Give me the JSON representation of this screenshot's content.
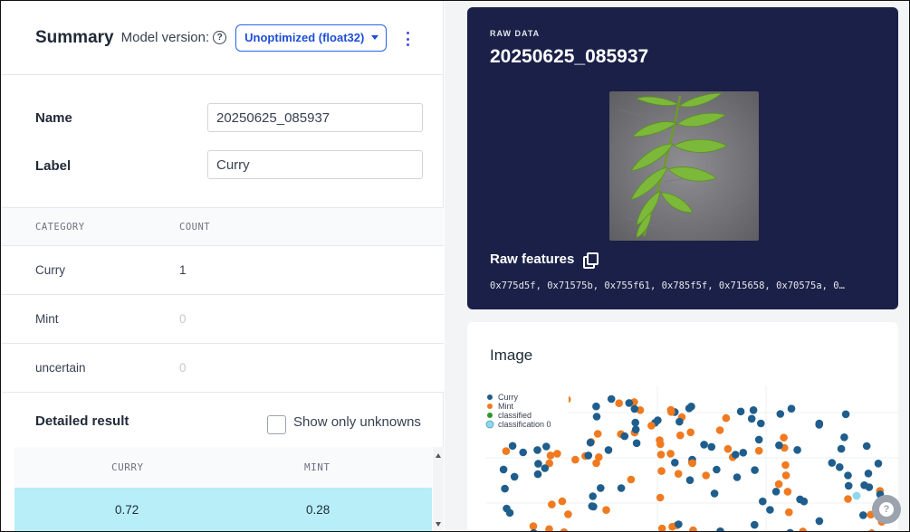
{
  "summary": {
    "title": "Summary",
    "model_version_label": "Model version:",
    "help_icon": "help-circle-icon",
    "model_version_value": "Unoptimized (float32)",
    "menu_icon": "vertical-dots-icon"
  },
  "fields": {
    "name_label": "Name",
    "name_value": "20250625_085937",
    "label_label": "Label",
    "label_value": "Curry"
  },
  "category_table": {
    "headers": [
      "CATEGORY",
      "COUNT"
    ],
    "rows": [
      {
        "category": "Curry",
        "count": "1"
      },
      {
        "category": "Mint",
        "count": "0"
      },
      {
        "category": "uncertain",
        "count": "0"
      }
    ]
  },
  "detailed": {
    "title": "Detailed result",
    "checkbox_label": "Show only unknowns",
    "headers": [
      "CURRY",
      "MINT"
    ],
    "rows": [
      {
        "curry": "0.72",
        "mint": "0.28"
      }
    ]
  },
  "raw": {
    "eyebrow": "RAW DATA",
    "title": "20250625_085937",
    "features_label": "Raw features",
    "features_hex": "0x775d5f, 0x71575b, 0x755f61, 0x785f5f, 0x715658, 0x70575a, 0…"
  },
  "image_panel": {
    "title": "Image",
    "legend": [
      {
        "name": "Curry",
        "color": "#1f5e8c"
      },
      {
        "name": "Mint",
        "color": "#f07a1f"
      },
      {
        "name": "classified",
        "color": "#2a9a2a"
      },
      {
        "name": "classification 0",
        "color": "#8fd8ec"
      }
    ]
  },
  "colors": {
    "accent": "#2563eb",
    "raw_card_bg": "#1b2048",
    "selected_row": "#b8eef8"
  },
  "help_fab_label": "?"
}
